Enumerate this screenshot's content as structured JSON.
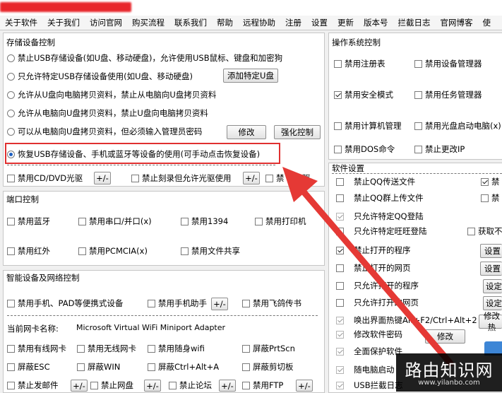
{
  "menu": [
    "关于软件",
    "关于我们",
    "访问官网",
    "购买流程",
    "联系我们",
    "帮助",
    "远程协助",
    "注册",
    "设置",
    "更新",
    "版本号",
    "拦截日志",
    "官网博客",
    "使"
  ],
  "storage": {
    "title": "存储设备控制",
    "radios": [
      {
        "label": "禁止USB存储设备(如U盘、移动硬盘)，允许使用USB鼠标、键盘和加密狗",
        "checked": false
      },
      {
        "label": "只允许特定USB存储设备使用(如U盘、移动硬盘)",
        "checked": false
      },
      {
        "label": "允许从U盘向电脑拷贝资料，禁止从电脑向U盘拷贝资料",
        "checked": false
      },
      {
        "label": "允许从电脑向U盘拷贝资料，禁止U盘向电脑拷贝资料",
        "checked": false
      },
      {
        "label": "可以从电脑向U盘拷贝资料，但必须输入管理员密码",
        "checked": false
      },
      {
        "label": "恢复USB存储设备、手机或蓝牙等设备的使用(可手动点击恢复设备)",
        "checked": true
      }
    ],
    "add_usb_btn": "添加特定U盘",
    "modify_btn": "修改",
    "enhance_btn": "强化控制",
    "cd_label": "禁用CD/DVD光驱",
    "burn_label": "禁止刻录但允许光驱使用",
    "floppy_label": "禁",
    "floppy_label2": "软驱",
    "pm": "+/-"
  },
  "port": {
    "title": "端口控制",
    "items": [
      "禁用蓝牙",
      "禁用串口/并口(x)",
      "禁用1394",
      "禁用打印机",
      "禁用红外",
      "禁用PCMCIA(x)",
      "禁用文件共享"
    ]
  },
  "smart": {
    "title": "智能设备及网络控制",
    "items": [
      "禁用手机、PAD等便携式设备",
      "禁用手机助手",
      "禁用飞鸽传书"
    ],
    "pm": "+/-",
    "nic_label": "当前网卡名称:",
    "nic_value": "Microsoft Virtual WiFi Miniport Adapter",
    "net_items": [
      "禁用有线网卡",
      "禁用无线网卡",
      "禁用随身wifi",
      "屏蔽PrtScn",
      "屏蔽ESC",
      "屏蔽WIN",
      "屏蔽Ctrl+Alt+A",
      "屏蔽剪切板",
      "禁止发邮件",
      "禁止网盘",
      "禁止论坛",
      "禁用FTP"
    ]
  },
  "os": {
    "title": "操作系统控制",
    "items": [
      {
        "label": "禁用注册表",
        "checked": false
      },
      {
        "label": "禁用设备管理器",
        "checked": false
      },
      {
        "label": "禁用安全模式",
        "checked": true
      },
      {
        "label": "禁用任务管理器",
        "checked": false
      },
      {
        "label": "禁用计算机管理",
        "checked": false
      },
      {
        "label": "禁用光盘启动电脑(x)",
        "checked": false
      },
      {
        "label": "禁用DOS命令",
        "checked": false
      },
      {
        "label": "禁止更改IP",
        "checked": false
      }
    ]
  },
  "soft": {
    "title": "软件设置",
    "items": [
      "禁止QQ传送文件",
      "禁止QQ群上传文件",
      "只允许特定QQ登陆",
      "只允许特定旺旺登陆",
      "禁止打开的程序",
      "禁止打开的网页",
      "只允许打开的程序",
      "只允许打开的网页",
      "唤出界面热键Alt+F2/Ctrl+Alt+2",
      "修改软件密码",
      "全面保护软件",
      "随电脑启动",
      "USB拦截日志"
    ],
    "right_items": [
      "禁",
      "禁",
      "获取不"
    ],
    "buttons": [
      "设置",
      "设置",
      "设定",
      "设定"
    ],
    "modify_btn": "修改",
    "modify_hotkey_btn": "修改热"
  },
  "watermark": {
    "line1": "路由知识网",
    "line2": "www.yilanbo.com"
  },
  "colors": {
    "highlight": "#e03030",
    "arrow": "#e53935"
  }
}
